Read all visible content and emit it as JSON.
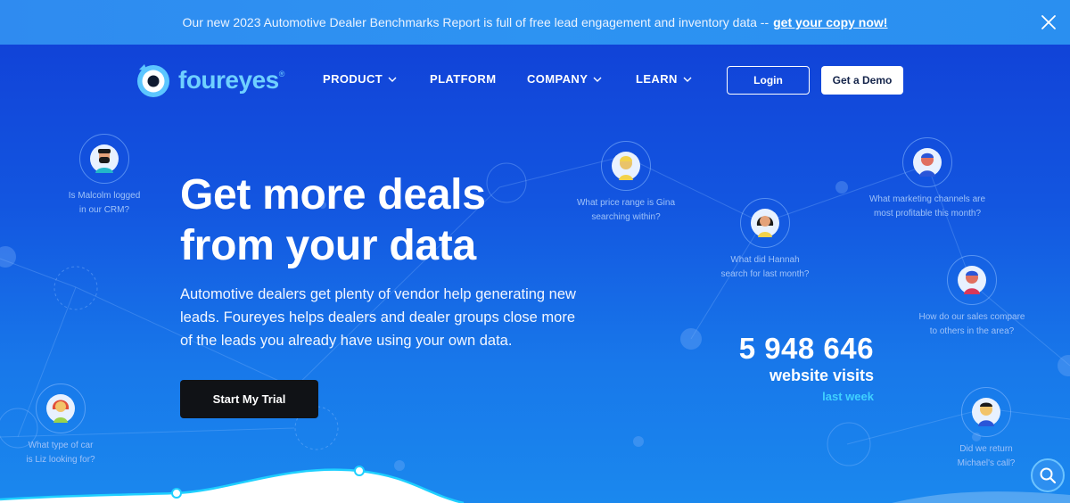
{
  "announcement": {
    "text": "Our new 2023 Automotive Dealer Benchmarks Report is full of free lead engagement and inventory data --",
    "link": "get your copy now!",
    "close_icon": "close-icon"
  },
  "brand": {
    "name": "foureyes",
    "trademark": "®",
    "color": "#6fd0ff"
  },
  "nav": {
    "product": "PRODUCT",
    "platform": "PLATFORM",
    "company": "COMPANY",
    "learn": "LEARN",
    "login": "Login",
    "demo": "Get a Demo"
  },
  "hero": {
    "headline": "Get more deals from your data",
    "body": "Automotive dealers get plenty of vendor help generating new leads. Foureyes helps dealers and dealer groups close more of the leads you already have using your own data.",
    "cta": "Start My Trial"
  },
  "stat": {
    "number": "5 948 646",
    "label": "website visits",
    "period": "last week",
    "accent": "#3fd0ff"
  },
  "personas": [
    {
      "question": "Is Malcolm logged\nin our CRM?"
    },
    {
      "question": "What price range is Gina\nsearching within?"
    },
    {
      "question": "What did Hannah\nsearch for last month?"
    },
    {
      "question": "What marketing channels are\nmost profitable this month?"
    },
    {
      "question": "How do our sales compare\nto others in the area?"
    },
    {
      "question": "What type of car\nis Liz looking for?"
    },
    {
      "question": "Did we return\nMichael's call?"
    }
  ],
  "chat_icon": "search-chat-icon"
}
